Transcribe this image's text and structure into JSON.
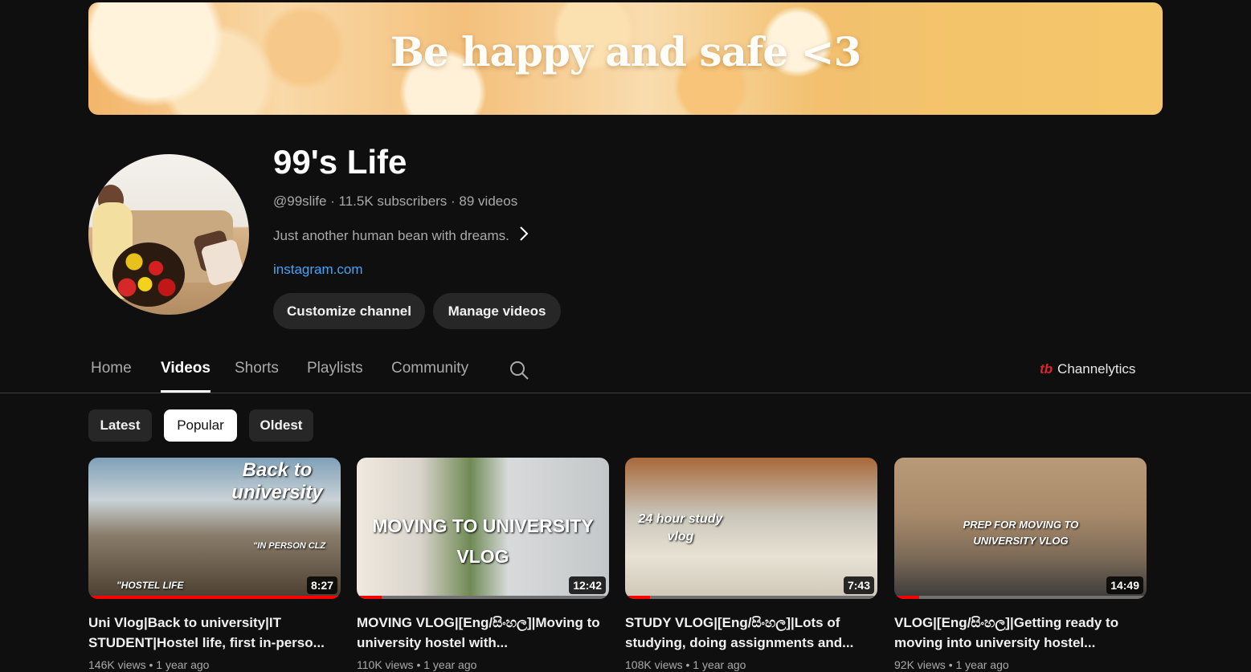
{
  "banner": {
    "text": "Be happy and safe <3"
  },
  "channel": {
    "name": "99's Life",
    "meta": "@99slife · 11.5K subscribers · 89 videos",
    "description": "Just another human bean with dreams.",
    "link": "instagram.com"
  },
  "buttons": {
    "customize": "Customize channel",
    "manage": "Manage videos"
  },
  "tabs": [
    {
      "label": "Home"
    },
    {
      "label": "Videos"
    },
    {
      "label": "Shorts"
    },
    {
      "label": "Playlists"
    },
    {
      "label": "Community"
    }
  ],
  "active_tab": "Videos",
  "extension": {
    "logo": "tb",
    "label": "Channelytics"
  },
  "chips": [
    {
      "label": "Latest"
    },
    {
      "label": "Popular"
    },
    {
      "label": "Oldest"
    }
  ],
  "active_chip": "Popular",
  "icons": {
    "search": "search-icon",
    "chevron": "chevron-right-icon"
  },
  "colors": {
    "accent_link": "#3ea6ff",
    "progress": "#ff0000",
    "background": "#0f0f0f"
  },
  "videos": [
    {
      "title": "Uni Vlog|Back to university|IT STUDENT|Hostel life, first in-perso...",
      "duration": "8:27",
      "meta": "146K views • 1 year ago",
      "overlay_text": "Back to university",
      "overlay_text2": "\"IN PERSON CLZ",
      "overlay_text3": "\"HOSTEL LIFE",
      "watched_fraction": 1.0
    },
    {
      "title": "MOVING VLOG|[Eng/සිංහල]|Moving to university hostel with...",
      "duration": "12:42",
      "meta": "110K views • 1 year ago",
      "overlay_text": "MOVING TO UNIVERSITY VLOG",
      "watched_fraction": 0.1
    },
    {
      "title": "STUDY VLOG|[Eng/සිංහල]|Lots of studying, doing assignments and...",
      "duration": "7:43",
      "meta": "108K views • 1 year ago",
      "overlay_text": "24 hour study vlog",
      "watched_fraction": 0.1
    },
    {
      "title": "VLOG|[Eng/සිංහල]|Getting ready to moving into university hostel...",
      "duration": "14:49",
      "meta": "92K views • 1 year ago",
      "overlay_text": "PREP FOR MOVING TO UNIVERSITY VLOG",
      "watched_fraction": 0.1
    }
  ]
}
